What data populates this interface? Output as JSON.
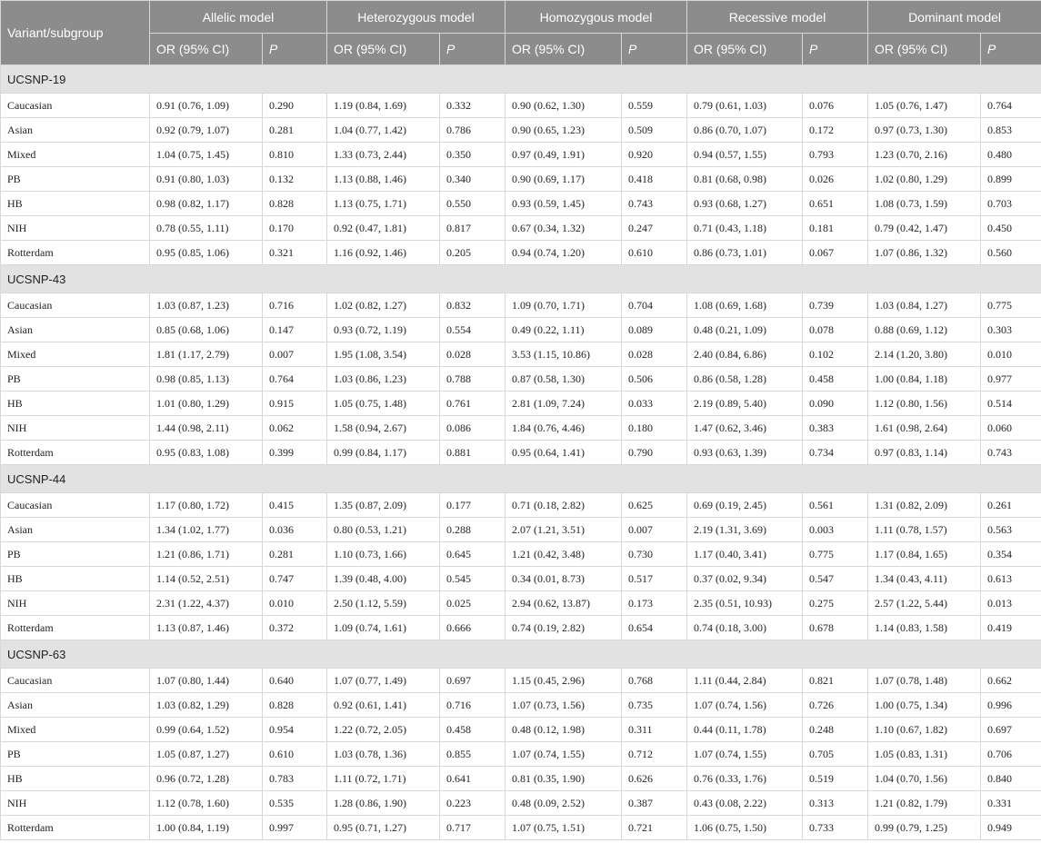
{
  "header": {
    "variant_label": "Variant/subgroup",
    "models": [
      "Allelic model",
      "Heterozygous model",
      "Homozygous model",
      "Recessive model",
      "Dominant model"
    ],
    "or_label": "OR (95% CI)",
    "p_label": "P"
  },
  "groups": [
    {
      "name": "UCSNP-19",
      "rows": [
        [
          "Caucasian",
          "0.91 (0.76, 1.09)",
          "0.290",
          "1.19 (0.84, 1.69)",
          "0.332",
          "0.90 (0.62, 1.30)",
          "0.559",
          "0.79 (0.61, 1.03)",
          "0.076",
          "1.05 (0.76, 1.47)",
          "0.764"
        ],
        [
          "Asian",
          "0.92 (0.79, 1.07)",
          "0.281",
          "1.04 (0.77, 1.42)",
          "0.786",
          "0.90 (0.65, 1.23)",
          "0.509",
          "0.86 (0.70, 1.07)",
          "0.172",
          "0.97 (0.73, 1.30)",
          "0.853"
        ],
        [
          "Mixed",
          "1.04 (0.75, 1.45)",
          "0.810",
          "1.33 (0.73, 2.44)",
          "0.350",
          "0.97 (0.49, 1.91)",
          "0.920",
          "0.94 (0.57, 1.55)",
          "0.793",
          "1.23 (0.70, 2.16)",
          "0.480"
        ],
        [
          "PB",
          "0.91 (0.80, 1.03)",
          "0.132",
          "1.13 (0.88, 1.46)",
          "0.340",
          "0.90 (0.69, 1.17)",
          "0.418",
          "0.81 (0.68, 0.98)",
          "0.026",
          "1.02 (0.80, 1.29)",
          "0.899"
        ],
        [
          "HB",
          "0.98 (0.82, 1.17)",
          "0.828",
          "1.13 (0.75, 1.71)",
          "0.550",
          "0.93 (0.59, 1.45)",
          "0.743",
          "0.93 (0.68, 1.27)",
          "0.651",
          "1.08 (0.73, 1.59)",
          "0.703"
        ],
        [
          "NIH",
          "0.78 (0.55, 1.11)",
          "0.170",
          "0.92 (0.47, 1.81)",
          "0.817",
          "0.67 (0.34, 1.32)",
          "0.247",
          "0.71 (0.43, 1.18)",
          "0.181",
          "0.79 (0.42, 1.47)",
          "0.450"
        ],
        [
          "Rotterdam",
          "0.95 (0.85, 1.06)",
          "0.321",
          "1.16 (0.92, 1.46)",
          "0.205",
          "0.94 (0.74, 1.20)",
          "0.610",
          "0.86 (0.73, 1.01)",
          "0.067",
          "1.07 (0.86, 1.32)",
          "0.560"
        ]
      ]
    },
    {
      "name": "UCSNP-43",
      "rows": [
        [
          "Caucasian",
          "1.03 (0.87, 1.23)",
          "0.716",
          "1.02 (0.82, 1.27)",
          "0.832",
          "1.09 (0.70, 1.71)",
          "0.704",
          "1.08 (0.69, 1.68)",
          "0.739",
          "1.03 (0.84, 1.27)",
          "0.775"
        ],
        [
          "Asian",
          "0.85 (0.68, 1.06)",
          "0.147",
          "0.93 (0.72, 1.19)",
          "0.554",
          "0.49 (0.22, 1.11)",
          "0.089",
          "0.48 (0.21, 1.09)",
          "0.078",
          "0.88 (0.69, 1.12)",
          "0.303"
        ],
        [
          "Mixed",
          "1.81 (1.17, 2.79)",
          "0.007",
          "1.95 (1.08, 3.54)",
          "0.028",
          "3.53 (1.15, 10.86)",
          "0.028",
          "2.40 (0.84, 6.86)",
          "0.102",
          "2.14 (1.20, 3.80)",
          "0.010"
        ],
        [
          "PB",
          "0.98 (0.85, 1.13)",
          "0.764",
          "1.03 (0.86, 1.23)",
          "0.788",
          "0.87 (0.58, 1.30)",
          "0.506",
          "0.86 (0.58, 1.28)",
          "0.458",
          "1.00 (0.84, 1.18)",
          "0.977"
        ],
        [
          "HB",
          "1.01 (0.80, 1.29)",
          "0.915",
          "1.05 (0.75, 1.48)",
          "0.761",
          "2.81 (1.09, 7.24)",
          "0.033",
          "2.19 (0.89, 5.40)",
          "0.090",
          "1.12 (0.80, 1.56)",
          "0.514"
        ],
        [
          "NIH",
          "1.44 (0.98, 2.11)",
          "0.062",
          "1.58 (0.94, 2.67)",
          "0.086",
          "1.84 (0.76, 4.46)",
          "0.180",
          "1.47 (0.62, 3.46)",
          "0.383",
          "1.61 (0.98, 2.64)",
          "0.060"
        ],
        [
          "Rotterdam",
          "0.95 (0.83, 1.08)",
          "0.399",
          "0.99 (0.84, 1.17)",
          "0.881",
          "0.95 (0.64, 1.41)",
          "0.790",
          "0.93 (0.63, 1.39)",
          "0.734",
          "0.97 (0.83, 1.14)",
          "0.743"
        ]
      ]
    },
    {
      "name": "UCSNP-44",
      "rows": [
        [
          "Caucasian",
          "1.17 (0.80, 1.72)",
          "0.415",
          "1.35 (0.87, 2.09)",
          "0.177",
          "0.71 (0.18, 2.82)",
          "0.625",
          "0.69 (0.19, 2.45)",
          "0.561",
          "1.31 (0.82, 2.09)",
          "0.261"
        ],
        [
          "Asian",
          "1.34 (1.02, 1.77)",
          "0.036",
          "0.80 (0.53, 1.21)",
          "0.288",
          "2.07 (1.21, 3.51)",
          "0.007",
          "2.19 (1.31, 3.69)",
          "0.003",
          "1.11 (0.78, 1.57)",
          "0.563"
        ],
        [
          "PB",
          "1.21 (0.86, 1.71)",
          "0.281",
          "1.10 (0.73, 1.66)",
          "0.645",
          "1.21 (0.42, 3.48)",
          "0.730",
          "1.17 (0.40, 3.41)",
          "0.775",
          "1.17 (0.84, 1.65)",
          "0.354"
        ],
        [
          "HB",
          "1.14 (0.52, 2.51)",
          "0.747",
          "1.39 (0.48, 4.00)",
          "0.545",
          "0.34 (0.01, 8.73)",
          "0.517",
          "0.37 (0.02, 9.34)",
          "0.547",
          "1.34 (0.43, 4.11)",
          "0.613"
        ],
        [
          "NIH",
          "2.31 (1.22, 4.37)",
          "0.010",
          "2.50 (1.12, 5.59)",
          "0.025",
          "2.94 (0.62, 13.87)",
          "0.173",
          "2.35 (0.51, 10.93)",
          "0.275",
          "2.57 (1.22, 5.44)",
          "0.013"
        ],
        [
          "Rotterdam",
          "1.13 (0.87, 1.46)",
          "0.372",
          "1.09 (0.74, 1.61)",
          "0.666",
          "0.74 (0.19, 2.82)",
          "0.654",
          "0.74 (0.18, 3.00)",
          "0.678",
          "1.14 (0.83, 1.58)",
          "0.419"
        ]
      ]
    },
    {
      "name": "UCSNP-63",
      "rows": [
        [
          "Caucasian",
          "1.07 (0.80, 1.44)",
          "0.640",
          "1.07 (0.77, 1.49)",
          "0.697",
          "1.15 (0.45, 2.96)",
          "0.768",
          "1.11 (0.44, 2.84)",
          "0.821",
          "1.07 (0.78, 1.48)",
          "0.662"
        ],
        [
          "Asian",
          "1.03 (0.82, 1.29)",
          "0.828",
          "0.92 (0.61, 1.41)",
          "0.716",
          "1.07 (0.73, 1.56)",
          "0.735",
          "1.07 (0.74, 1.56)",
          "0.726",
          "1.00 (0.75, 1.34)",
          "0.996"
        ],
        [
          "Mixed",
          "0.99 (0.64, 1.52)",
          "0.954",
          "1.22 (0.72, 2.05)",
          "0.458",
          "0.48 (0.12, 1.98)",
          "0.311",
          "0.44 (0.11, 1.78)",
          "0.248",
          "1.10 (0.67, 1.82)",
          "0.697"
        ],
        [
          "PB",
          "1.05 (0.87, 1.27)",
          "0.610",
          "1.03 (0.78, 1.36)",
          "0.855",
          "1.07 (0.74, 1.55)",
          "0.712",
          "1.07 (0.74, 1.55)",
          "0.705",
          "1.05 (0.83, 1.31)",
          "0.706"
        ],
        [
          "HB",
          "0.96 (0.72, 1.28)",
          "0.783",
          "1.11 (0.72, 1.71)",
          "0.641",
          "0.81 (0.35, 1.90)",
          "0.626",
          "0.76 (0.33, 1.76)",
          "0.519",
          "1.04 (0.70, 1.56)",
          "0.840"
        ],
        [
          "NIH",
          "1.12 (0.78, 1.60)",
          "0.535",
          "1.28 (0.86, 1.90)",
          "0.223",
          "0.48 (0.09, 2.52)",
          "0.387",
          "0.43 (0.08, 2.22)",
          "0.313",
          "1.21 (0.82, 1.79)",
          "0.331"
        ],
        [
          "Rotterdam",
          "1.00 (0.84, 1.19)",
          "0.997",
          "0.95 (0.71, 1.27)",
          "0.717",
          "1.07 (0.75, 1.51)",
          "0.721",
          "1.06 (0.75, 1.50)",
          "0.733",
          "0.99 (0.79, 1.25)",
          "0.949"
        ]
      ]
    }
  ]
}
